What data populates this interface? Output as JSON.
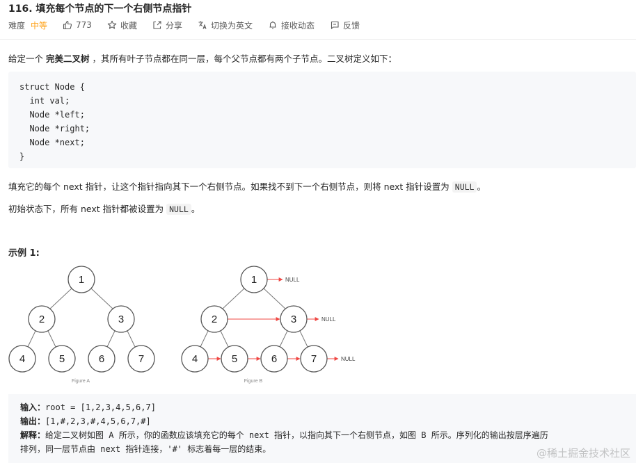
{
  "title": "116. 填充每个节点的下一个右侧节点指针",
  "meta": {
    "difficulty_label": "难度",
    "difficulty_value": "中等",
    "likes": "773",
    "favorite": "收藏",
    "share": "分享",
    "switch_lang": "切换为英文",
    "subscribe": "接收动态",
    "feedback": "反馈"
  },
  "desc": {
    "p1_pre": "给定一个 ",
    "p1_bold": "完美二叉树",
    "p1_post": " ，其所有叶子节点都在同一层，每个父节点都有两个子节点。二叉树定义如下：",
    "code": "struct Node {\n  int val;\n  Node *left;\n  Node *right;\n  Node *next;\n}",
    "p2_pre": "填充它的每个 next 指针，让这个指针指向其下一个右侧节点。如果找不到下一个右侧节点，则将 next 指针设置为 ",
    "p2_code": "NULL",
    "p2_post": "。",
    "p3_pre": "初始状态下，所有 next 指针都被设置为 ",
    "p3_code": "NULL",
    "p3_post": "。"
  },
  "example": {
    "title": "示例 1:",
    "figure_a_caption": "Figure A",
    "figure_b_caption": "Figure B",
    "null_label": "NULL",
    "nodes": [
      "1",
      "2",
      "3",
      "4",
      "5",
      "6",
      "7"
    ],
    "input_label": "输入：",
    "input_value": "root = [1,2,3,4,5,6,7]",
    "output_label": "输出：",
    "output_value": "[1,#,2,3,#,4,5,6,7,#]",
    "explain_label": "解释：",
    "explain_line1": "给定二叉树如图 A 所示，你的函数应该填充它的每个 next 指针，以指向其下一个右侧节点，如图 B 所示。序列化的输出按层序遍历",
    "explain_line2": "排列，同一层节点由 next 指针连接，'#' 标志着每一层的结束。"
  },
  "watermark": "@稀土掘金技术社区",
  "colors": {
    "accent": "#ffa116",
    "arrow": "#ef4743"
  }
}
